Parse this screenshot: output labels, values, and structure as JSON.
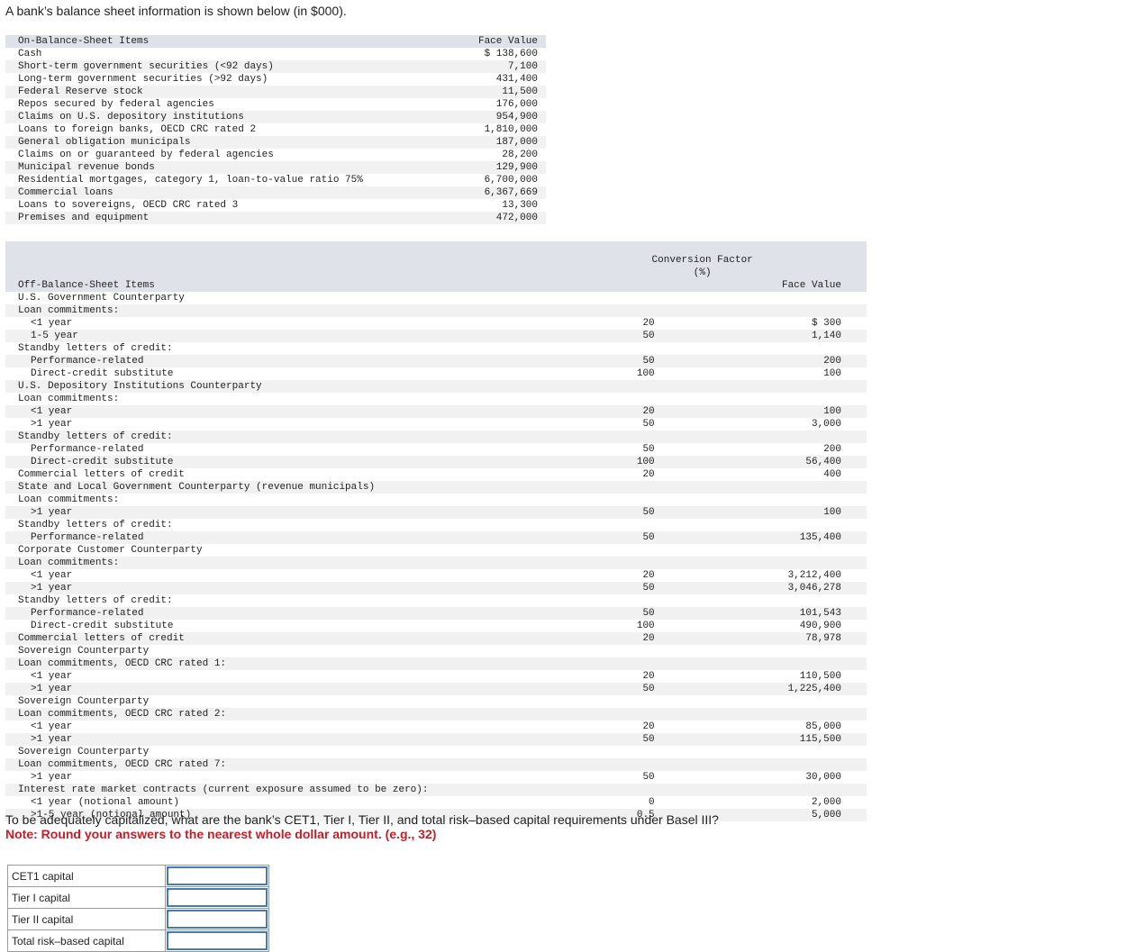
{
  "intro": "A bank’s balance sheet information is shown below (in $000).",
  "on_balance": {
    "header_label": "On-Balance-Sheet Items",
    "header_value": "Face Value",
    "rows": [
      {
        "label": "Cash",
        "value": "$ 138,600"
      },
      {
        "label": "Short-term government securities (<92 days)",
        "value": "7,100"
      },
      {
        "label": "Long-term government securities (>92 days)",
        "value": "431,400"
      },
      {
        "label": "Federal Reserve stock",
        "value": "11,500"
      },
      {
        "label": "Repos secured by federal agencies",
        "value": "176,000"
      },
      {
        "label": "Claims on U.S. depository institutions",
        "value": "954,900"
      },
      {
        "label": "Loans to foreign banks, OECD CRC rated 2",
        "value": "1,810,000"
      },
      {
        "label": "General obligation municipals",
        "value": "187,000"
      },
      {
        "label": "Claims on or guaranteed by federal agencies",
        "value": "28,200"
      },
      {
        "label": "Municipal revenue bonds",
        "value": "129,900"
      },
      {
        "label": "Residential mortgages, category 1, loan-to-value ratio 75%",
        "value": "6,700,000"
      },
      {
        "label": "Commercial loans",
        "value": "6,367,669"
      },
      {
        "label": "Loans to sovereigns, OECD CRC rated 3",
        "value": "13,300"
      },
      {
        "label": "Premises and equipment",
        "value": "472,000"
      }
    ]
  },
  "off_balance": {
    "header_label": "Off-Balance-Sheet Items",
    "header_cf_line1": "Conversion Factor",
    "header_cf_line2": "(%)",
    "header_value": "Face Value",
    "rows": [
      {
        "label": "U.S. Government Counterparty",
        "indent": 0,
        "cf": "",
        "fv": ""
      },
      {
        "label": "Loan commitments:",
        "indent": 0,
        "cf": "",
        "fv": ""
      },
      {
        "label": "<1 year",
        "indent": 1,
        "cf": "20",
        "fv": "$ 300"
      },
      {
        "label": "1-5 year",
        "indent": 1,
        "cf": "50",
        "fv": "1,140"
      },
      {
        "label": "Standby letters of credit:",
        "indent": 0,
        "cf": "",
        "fv": ""
      },
      {
        "label": "Performance-related",
        "indent": 1,
        "cf": "50",
        "fv": "200"
      },
      {
        "label": "Direct-credit substitute",
        "indent": 1,
        "cf": "100",
        "fv": "100"
      },
      {
        "label": "U.S. Depository Institutions Counterparty",
        "indent": 0,
        "cf": "",
        "fv": ""
      },
      {
        "label": "Loan commitments:",
        "indent": 0,
        "cf": "",
        "fv": ""
      },
      {
        "label": "<1 year",
        "indent": 1,
        "cf": "20",
        "fv": "100"
      },
      {
        "label": ">1 year",
        "indent": 1,
        "cf": "50",
        "fv": "3,000"
      },
      {
        "label": "Standby letters of credit:",
        "indent": 0,
        "cf": "",
        "fv": ""
      },
      {
        "label": "Performance-related",
        "indent": 1,
        "cf": "50",
        "fv": "200"
      },
      {
        "label": "Direct-credit substitute",
        "indent": 1,
        "cf": "100",
        "fv": "56,400"
      },
      {
        "label": "Commercial letters of credit",
        "indent": 0,
        "cf": "20",
        "fv": "400"
      },
      {
        "label": "State and Local Government Counterparty (revenue municipals)",
        "indent": 0,
        "cf": "",
        "fv": ""
      },
      {
        "label": "Loan commitments:",
        "indent": 0,
        "cf": "",
        "fv": ""
      },
      {
        "label": ">1 year",
        "indent": 1,
        "cf": "50",
        "fv": "100"
      },
      {
        "label": "Standby letters of credit:",
        "indent": 0,
        "cf": "",
        "fv": ""
      },
      {
        "label": "Performance-related",
        "indent": 1,
        "cf": "50",
        "fv": "135,400"
      },
      {
        "label": "Corporate Customer Counterparty",
        "indent": 0,
        "cf": "",
        "fv": ""
      },
      {
        "label": "Loan commitments:",
        "indent": 0,
        "cf": "",
        "fv": ""
      },
      {
        "label": "<1 year",
        "indent": 1,
        "cf": "20",
        "fv": "3,212,400"
      },
      {
        "label": ">1 year",
        "indent": 1,
        "cf": "50",
        "fv": "3,046,278"
      },
      {
        "label": "Standby letters of credit:",
        "indent": 0,
        "cf": "",
        "fv": ""
      },
      {
        "label": "Performance-related",
        "indent": 1,
        "cf": "50",
        "fv": "101,543"
      },
      {
        "label": "Direct-credit substitute",
        "indent": 1,
        "cf": "100",
        "fv": "490,900"
      },
      {
        "label": "Commercial letters of credit",
        "indent": 0,
        "cf": "20",
        "fv": "78,978"
      },
      {
        "label": "Sovereign Counterparty",
        "indent": 0,
        "cf": "",
        "fv": ""
      },
      {
        "label": "Loan commitments, OECD CRC rated 1:",
        "indent": 0,
        "cf": "",
        "fv": ""
      },
      {
        "label": "<1 year",
        "indent": 1,
        "cf": "20",
        "fv": "110,500"
      },
      {
        "label": ">1 year",
        "indent": 1,
        "cf": "50",
        "fv": "1,225,400"
      },
      {
        "label": "Sovereign Counterparty",
        "indent": 0,
        "cf": "",
        "fv": ""
      },
      {
        "label": "Loan commitments, OECD CRC rated 2:",
        "indent": 0,
        "cf": "",
        "fv": ""
      },
      {
        "label": "<1 year",
        "indent": 1,
        "cf": "20",
        "fv": "85,000"
      },
      {
        "label": ">1 year",
        "indent": 1,
        "cf": "50",
        "fv": "115,500"
      },
      {
        "label": "Sovereign Counterparty",
        "indent": 0,
        "cf": "",
        "fv": ""
      },
      {
        "label": "Loan commitments, OECD CRC rated 7:",
        "indent": 0,
        "cf": "",
        "fv": ""
      },
      {
        "label": ">1 year",
        "indent": 1,
        "cf": "50",
        "fv": "30,000"
      },
      {
        "label": "Interest rate market contracts (current exposure assumed to be zero):",
        "indent": 0,
        "cf": "",
        "fv": ""
      },
      {
        "label": "<1 year (notional amount)",
        "indent": 1,
        "cf": "0",
        "fv": "2,000"
      },
      {
        "label": ">1-5 year (notional amount)",
        "indent": 1,
        "cf": "0.5",
        "fv": "5,000"
      }
    ]
  },
  "question": "To be adequately capitalized, what are the bank’s CET1, Tier I, Tier II, and total risk–based capital requirements under Basel III?",
  "note": "Note: Round your answers to the nearest whole dollar amount. (e.g., 32)",
  "answers": [
    {
      "label": "CET1 capital",
      "value": ""
    },
    {
      "label": "Tier I capital",
      "value": ""
    },
    {
      "label": "Tier II capital",
      "value": ""
    },
    {
      "label": "Total risk–based capital",
      "value": ""
    }
  ]
}
